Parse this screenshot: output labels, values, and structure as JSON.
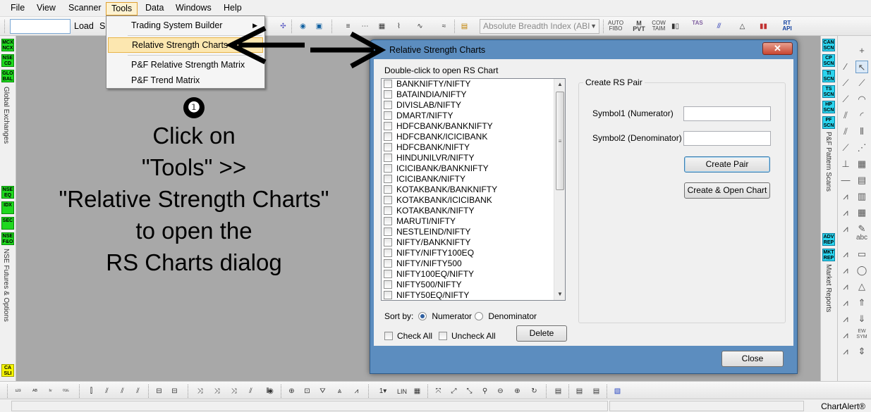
{
  "menubar": [
    "File",
    "View",
    "Scanner",
    "Tools",
    "Data",
    "Windows",
    "Help"
  ],
  "toolbar": {
    "load_label": "Load",
    "s_label": "S",
    "index_combo": "Absolute Breadth Index (ABI",
    "mini_icons": [
      "AUTO FIBO",
      "M PVT",
      "COW TAIM",
      "TAS",
      "RT API"
    ]
  },
  "tools_menu": {
    "items": [
      "Trading System Builder",
      "Relative Strength Charts",
      "P&F Relative Strength Matrix",
      "P&F Trend Matrix"
    ]
  },
  "instruction": {
    "step": "❶",
    "lines": [
      "Click on",
      "\"Tools\" >>",
      "\"Relative Strength Charts\"",
      "to open the",
      "RS Charts dialog"
    ]
  },
  "left_strip": {
    "badges": [
      "MCX NCX",
      "NSE CD",
      "GLO BAL",
      "NSE EQ",
      "IDX",
      "SEC",
      "NSE F&O",
      "CA SLI"
    ],
    "labels": [
      "Global Exchanges",
      "NSE Futures & Options"
    ]
  },
  "right_strip": {
    "badges": [
      "CAN SCN",
      "CP SCN",
      "TI SCN",
      "TS SCN",
      "HP SCN",
      "PF SCN",
      "ADV REP",
      "MKT REP"
    ],
    "labels": [
      "P&F Pattern Scans",
      "Market Reports"
    ],
    "draw_labels": [
      "abc",
      "EW SYM"
    ]
  },
  "dialog": {
    "title": "Relative Strength Charts",
    "close_x": "✕",
    "list_label": "Double-click to open RS Chart",
    "pairs": [
      "BANKNIFTY/NIFTY",
      "BATAINDIA/NIFTY",
      "DIVISLAB/NIFTY",
      "DMART/NIFTY",
      "HDFCBANK/BANKNIFTY",
      "HDFCBANK/ICICIBANK",
      "HDFCBANK/NIFTY",
      "HINDUNILVR/NIFTY",
      "ICICIBANK/BANKNIFTY",
      "ICICIBANK/NIFTY",
      "KOTAKBANK/BANKNIFTY",
      "KOTAKBANK/ICICIBANK",
      "KOTAKBANK/NIFTY",
      "MARUTI/NIFTY",
      "NESTLEIND/NIFTY",
      "NIFTY/BANKNIFTY",
      "NIFTY/NIFTY100EQ",
      "NIFTY/NIFTY500",
      "NIFTY100EQ/NIFTY",
      "NIFTY500/NIFTY",
      "NIFTY50EQ/NIFTY"
    ],
    "sort_by_label": "Sort by:",
    "sort_options": [
      "Numerator",
      "Denominator"
    ],
    "check_all": "Check All",
    "uncheck_all": "Uncheck All",
    "delete_btn": "Delete",
    "group_title": "Create RS Pair",
    "symbol1_label": "Symbol1 (Numerator)",
    "symbol2_label": "Symbol2 (Denominator)",
    "symbol1_value": "",
    "symbol2_value": "",
    "create_pair_btn": "Create Pair",
    "create_open_btn": "Create & Open Chart",
    "close_btn": "Close"
  },
  "status": {
    "brand": "ChartAlert®"
  }
}
